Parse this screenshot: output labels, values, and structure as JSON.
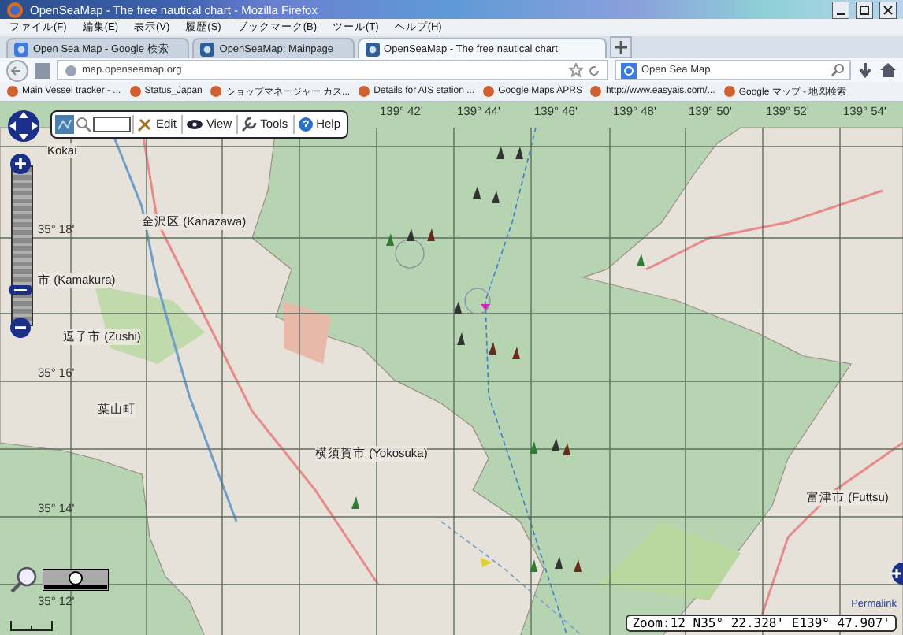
{
  "window": {
    "title": "OpenSeaMap - The free nautical chart - Mozilla Firefox"
  },
  "menu": [
    "ファイル(F)",
    "編集(E)",
    "表示(V)",
    "履歴(S)",
    "ブックマーク(B)",
    "ツール(T)",
    "ヘルプ(H)"
  ],
  "tabs": [
    {
      "label": "Open Sea Map - Google 検索",
      "selected": false
    },
    {
      "label": "OpenSeaMap: Mainpage",
      "selected": false
    },
    {
      "label": "OpenSeaMap - The free nautical chart",
      "selected": true
    }
  ],
  "address_bar": {
    "url": "map.openseamap.org"
  },
  "search_field": {
    "value": "Open Sea Map"
  },
  "bookmarks": [
    "Main Vessel tracker - ...",
    "Status_Japan",
    "ショップマネージャー カス...",
    "Details for AIS station ...",
    "Google Maps APRS",
    "http://www.easyais.com/...",
    "Google マップ - 地図検索"
  ],
  "map": {
    "zoom_slider": {
      "level": 0.2
    },
    "toolbar": [
      {
        "kind": "edit",
        "label": "Edit"
      },
      {
        "kind": "view",
        "label": "View"
      },
      {
        "kind": "tools",
        "label": "Tools"
      },
      {
        "kind": "help",
        "label": "Help"
      }
    ],
    "longitude_labels": [
      "139° 42'",
      "139° 44'",
      "139° 46'",
      "139° 48'",
      "139° 50'",
      "139° 52'",
      "139° 54'"
    ],
    "latitude_labels": [
      "35° 18'",
      "35° 16'",
      "35° 14'",
      "35° 12'"
    ],
    "place_labels": [
      "Kokai",
      "金沢区 (Kanazawa)",
      "市 (Kamakura)",
      "逗子市 (Zushi)",
      "葉山町",
      "横須賀市 (Yokosuka)",
      "富津市 (Futtsu)"
    ],
    "status": "Zoom:12 N35° 22.328' E139° 47.907'",
    "permalink": "Permalink"
  }
}
